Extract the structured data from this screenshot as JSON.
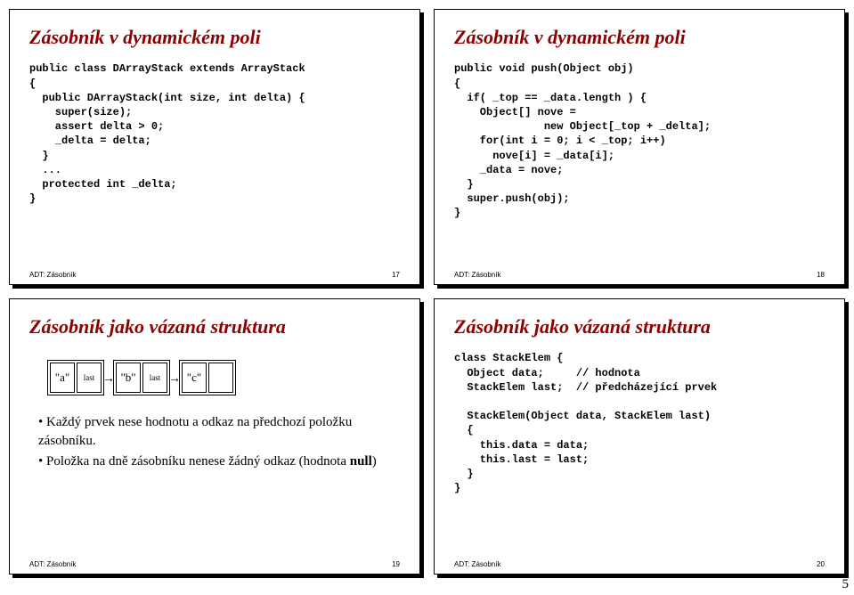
{
  "slides": {
    "s17": {
      "title": "Zásobník v dynamickém poli",
      "code": "public class DArrayStack extends ArrayStack\n{\n  public DArrayStack(int size, int delta) {\n    super(size);\n    assert delta > 0;\n    _delta = delta;\n  }\n  ...\n  protected int _delta;\n}",
      "footer_left": "ADT: Zásobník",
      "footer_right": "17"
    },
    "s18": {
      "title": "Zásobník v dynamickém poli",
      "code": "public void push(Object obj)\n{\n  if( _top == _data.length ) {\n    Object[] nove =\n              new Object[_top + _delta];\n    for(int i = 0; i < _top; i++)\n      nove[i] = _data[i];\n    _data = nove;\n  }\n  super.push(obj);\n}",
      "footer_left": "ADT: Zásobník",
      "footer_right": "18"
    },
    "s19": {
      "title": "Zásobník jako vázaná struktura",
      "diagram": {
        "a": "\"a\"",
        "b": "\"b\"",
        "c": "\"c\"",
        "last": "last"
      },
      "bullets": {
        "b1": "• Každý prvek nese hodnotu a odkaz na předchozí položku zásobníku.",
        "b2_a": "• Položka na dně zásobníku nenese žádný odkaz (hodnota ",
        "b2_b": "null",
        "b2_c": ")"
      },
      "footer_left": "ADT: Zásobník",
      "footer_right": "19"
    },
    "s20": {
      "title": "Zásobník jako vázaná struktura",
      "code": "class StackElem {\n  Object data;     // hodnota\n  StackElem last;  // předcházející prvek\n\n  StackElem(Object data, StackElem last)\n  {\n    this.data = data;\n    this.last = last;\n  }\n}",
      "footer_left": "ADT: Zásobník",
      "footer_right": "20"
    }
  },
  "page_number": "5"
}
